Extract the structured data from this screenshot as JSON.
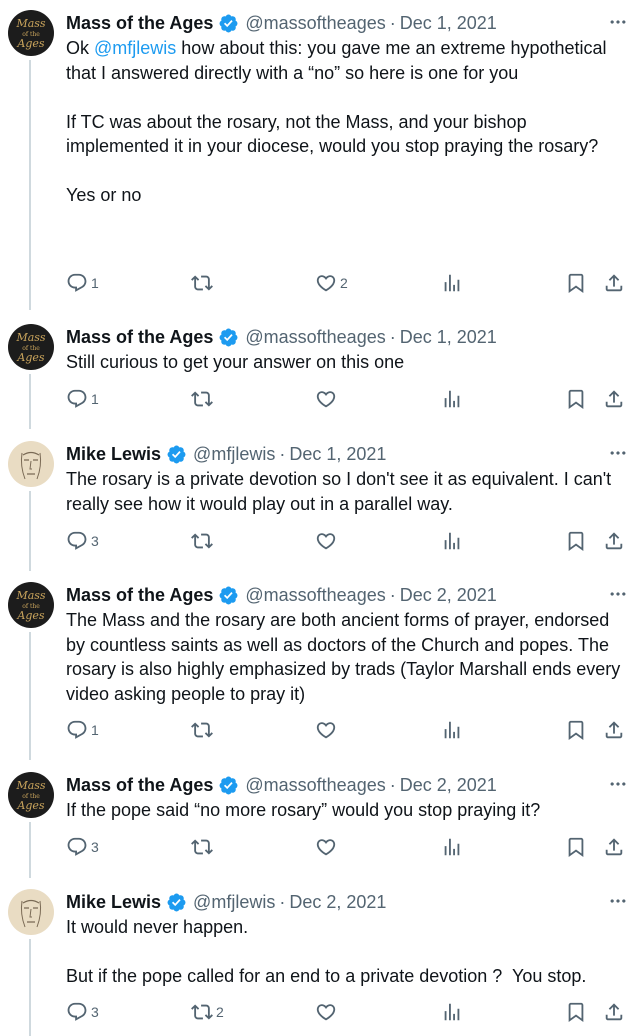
{
  "tweets": [
    {
      "name": "Mass of the Ages",
      "handle": "@massoftheages",
      "date": "Dec 1, 2021",
      "text_pre": "Ok ",
      "mention": "@mfjlewis",
      "text_post": " how about this: you gave me an extreme hypothetical that I answered directly with a “no” so here is one for you",
      "para2": "If TC was about the rosary, not the Mass, and your bishop implemented it in your diocese, would you stop praying the rosary?",
      "para3": "Yes or no",
      "replies": "1",
      "retweets": "",
      "likes": "2"
    },
    {
      "name": "Mass of the Ages",
      "handle": "@massoftheages",
      "date": "Dec 1, 2021",
      "text": "Still curious to get your answer on this one",
      "replies": "1",
      "retweets": "",
      "likes": ""
    },
    {
      "name": "Mike Lewis",
      "handle": "@mfjlewis",
      "date": "Dec 1, 2021",
      "text": "The rosary is a private devotion so I don't see it as equivalent. I can't really see how it would play out in a parallel way.",
      "replies": "3",
      "retweets": "",
      "likes": ""
    },
    {
      "name": "Mass of the Ages",
      "handle": "@massoftheages",
      "date": "Dec 2, 2021",
      "text": "The Mass and the rosary are both ancient forms of prayer, endorsed by countless saints as well as doctors of the Church and popes. The rosary is also highly emphasized by trads (Taylor Marshall ends every video asking people to pray it)",
      "replies": "1",
      "retweets": "",
      "likes": ""
    },
    {
      "name": "Mass of the Ages",
      "handle": "@massoftheages",
      "date": "Dec 2, 2021",
      "text": "If the pope said “no more rosary” would you stop praying it?",
      "replies": "3",
      "retweets": "",
      "likes": ""
    },
    {
      "name": "Mike Lewis",
      "handle": "@mfjlewis",
      "date": "Dec 2, 2021",
      "text": "It would never happen.",
      "para2": "But if the pope called for an end to a private devotion ?  You stop.",
      "replies": "3",
      "retweets": "2",
      "likes": ""
    }
  ],
  "avatars": {
    "mass_of_the_ages": {
      "text_line1": "Mass",
      "text_line2": "of the",
      "text_line3": "Ages",
      "bg": "#1c1c1c",
      "fg": "#c9a45c"
    },
    "mike_lewis": {
      "bg": "#e9dcc3",
      "fg": "#7a6a55"
    }
  },
  "colors": {
    "verified": "#1d9bf0",
    "mention": "#1d9bf0",
    "muted": "#536471",
    "text": "#0f1419",
    "rail": "#cfd9de"
  }
}
